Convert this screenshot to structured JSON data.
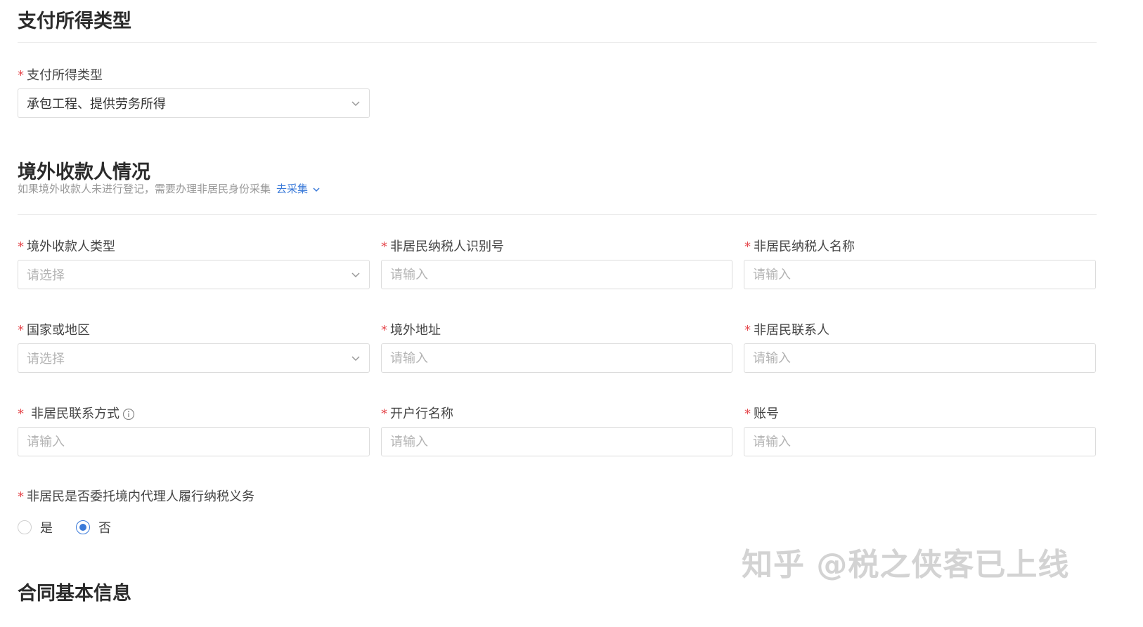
{
  "section1": {
    "title": "支付所得类型",
    "field_label": "支付所得类型",
    "field_value": "承包工程、提供劳务所得"
  },
  "section2": {
    "title": "境外收款人情况",
    "subtitle": "如果境外收款人未进行登记，需要办理非居民身份采集",
    "link": "去采集",
    "fields": [
      {
        "label": "境外收款人类型",
        "placeholder": "请选择"
      },
      {
        "label": "非居民纳税人识别号",
        "placeholder": "请输入"
      },
      {
        "label": "非居民纳税人名称",
        "placeholder": "请输入"
      },
      {
        "label": "国家或地区",
        "placeholder": "请选择"
      },
      {
        "label": "境外地址",
        "placeholder": "请输入"
      },
      {
        "label": "非居民联系人",
        "placeholder": "请输入"
      },
      {
        "label": "非居民联系方式",
        "placeholder": "请输入"
      },
      {
        "label": "开户行名称",
        "placeholder": "请输入"
      },
      {
        "label": "账号",
        "placeholder": "请输入"
      }
    ],
    "agent_question": "非居民是否委托境内代理人履行纳税义务",
    "radio_yes": "是",
    "radio_no": "否",
    "radio_selected": "否"
  },
  "section3": {
    "title": "合同基本信息"
  },
  "required_mark": "*",
  "watermark": "知乎 @税之侠客已上线",
  "colors": {
    "required": "#e5484d",
    "accent": "#3a7ad9",
    "placeholder": "#b3b3b3",
    "border": "#dcdcdc"
  },
  "icons": {
    "select_arrow": "chevron-down-icon",
    "info": "info-icon"
  }
}
